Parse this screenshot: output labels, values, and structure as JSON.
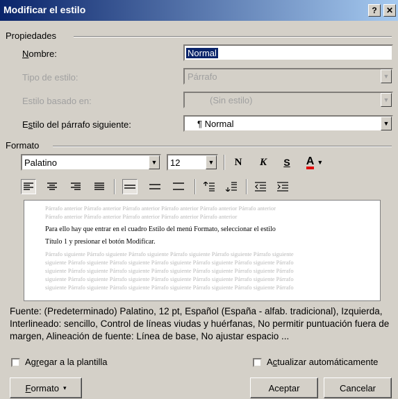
{
  "window": {
    "title": "Modificar el estilo",
    "help_label": "?",
    "close_label": "✕"
  },
  "properties": {
    "group_label": "Propiedades",
    "name_label": "Nombre:",
    "name_value": "Normal",
    "type_label": "Tipo de estilo:",
    "type_value": "Párrafo",
    "based_label": "Estilo basado en:",
    "based_value": "(Sin estilo)",
    "next_label": "Estilo del párrafo siguiente:",
    "next_value": "¶ Normal"
  },
  "format": {
    "group_label": "Formato",
    "font_value": "Palatino",
    "size_value": "12",
    "bold": "N",
    "italic": "K",
    "underline": "S",
    "color_letter": "A",
    "font_color": "#e00000"
  },
  "preview": {
    "prev_lines": [
      "Párrafo anterior Párrafo anterior Párrafo anterior Párrafo anterior Párrafo anterior Párrafo anterior",
      "Párrafo anterior Párrafo anterior Párrafo anterior Párrafo anterior Párrafo anterior"
    ],
    "main_lines": [
      "Para ello hay que entrar en el cuadro Estilo del menú Formato, seleccionar el estilo",
      "Título 1 y presionar el botón Modificar."
    ],
    "next_lines": [
      "Párrafo siguiente Párrafo siguiente Párrafo siguiente Párrafo siguiente Párrafo siguiente Párrafo siguiente",
      "siguiente Párrafo siguiente Párrafo siguiente Párrafo siguiente Párrafo siguiente Párrafo siguiente Párrafo",
      "siguiente Párrafo siguiente Párrafo siguiente Párrafo siguiente Párrafo siguiente Párrafo siguiente Párrafo",
      "siguiente Párrafo siguiente Párrafo siguiente Párrafo siguiente Párrafo siguiente Párrafo siguiente Párrafo",
      "siguiente Párrafo siguiente Párrafo siguiente Párrafo siguiente Párrafo siguiente Párrafo siguiente Párrafo"
    ]
  },
  "description": "Fuente: (Predeterminado) Palatino, 12 pt, Español (España - alfab. tradicional), Izquierda, Interlineado:  sencillo, Control de líneas viudas y huérfanas, No permitir puntuación fuera de margen, Alineación de fuente: Línea de base, No ajustar espacio ...",
  "options": {
    "add_template_label": "Agregar a la plantilla",
    "auto_update_label": "Actualizar automáticamente"
  },
  "buttons": {
    "format_label": "Formato",
    "format_arrow": "▾",
    "ok_label": "Aceptar",
    "cancel_label": "Cancelar"
  }
}
